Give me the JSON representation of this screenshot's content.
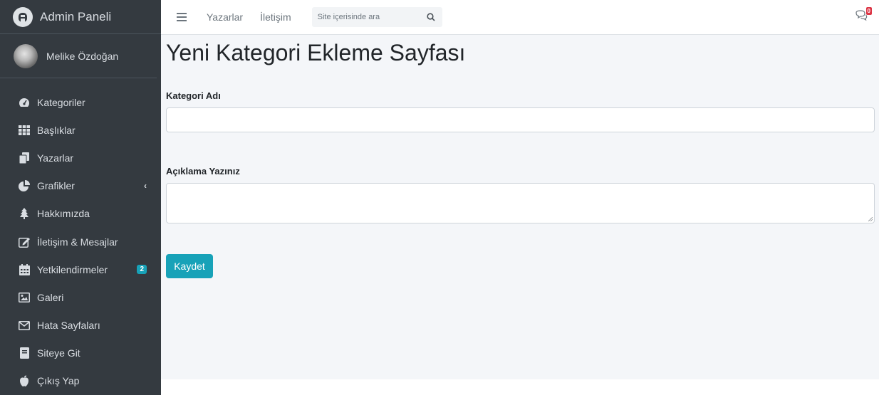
{
  "brand": {
    "title": "Admin Paneli"
  },
  "user": {
    "name": "Melike Özdoğan"
  },
  "sidebar": {
    "items": [
      {
        "label": "Kategoriler",
        "icon": "tachometer-icon"
      },
      {
        "label": "Başlıklar",
        "icon": "grid-icon"
      },
      {
        "label": "Yazarlar",
        "icon": "copy-icon"
      },
      {
        "label": "Grafikler",
        "icon": "pie-chart-icon",
        "arrow": "‹"
      },
      {
        "label": "Hakkımızda",
        "icon": "tree-icon"
      },
      {
        "label": "İletişim & Mesajlar",
        "icon": "edit-icon"
      },
      {
        "label": "Yetkilendirmeler",
        "icon": "calendar-icon",
        "badge": "2"
      },
      {
        "label": "Galeri",
        "icon": "image-icon"
      },
      {
        "label": "Hata Sayfaları",
        "icon": "envelope-icon"
      },
      {
        "label": "Siteye Git",
        "icon": "book-icon"
      },
      {
        "label": "Çıkış Yap",
        "icon": "apple-icon"
      }
    ]
  },
  "topbar": {
    "links": [
      "Yazarlar",
      "İletişim"
    ],
    "search_placeholder": "Site içerisinde ara",
    "messages_badge": "0"
  },
  "main": {
    "title": "Yeni Kategori Ekleme Sayfası",
    "category_label": "Kategori Adı",
    "category_value": "",
    "description_label": "Açıklama Yazınız",
    "description_value": "",
    "save_label": "Kaydet"
  },
  "colors": {
    "sidebar_bg": "#343a40",
    "content_bg": "#f4f6f9",
    "accent": "#17a2b8",
    "danger": "#dc3545"
  }
}
